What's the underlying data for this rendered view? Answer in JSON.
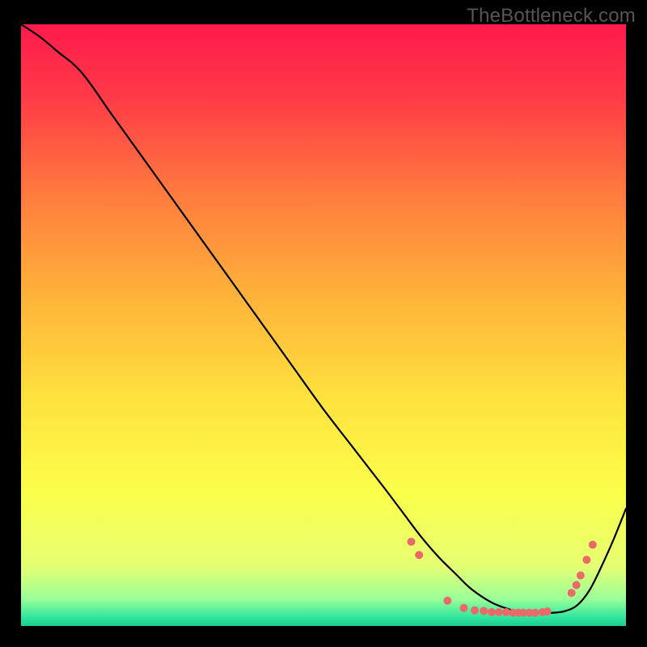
{
  "watermark": "TheBottleneck.com",
  "colors": {
    "black": "#000000",
    "curve": "#000000",
    "dot": "#ea6a6a"
  },
  "chart_data": {
    "type": "line",
    "title": "",
    "xlabel": "",
    "ylabel": "",
    "xlim": [
      0,
      100
    ],
    "ylim": [
      0,
      100
    ],
    "grid": false,
    "legend": false,
    "background": {
      "type": "vertical-gradient",
      "stops": [
        {
          "offset": 0.0,
          "color": "#ff1a4b"
        },
        {
          "offset": 0.12,
          "color": "#ff3a47"
        },
        {
          "offset": 0.28,
          "color": "#ff7a3e"
        },
        {
          "offset": 0.45,
          "color": "#ffb23a"
        },
        {
          "offset": 0.62,
          "color": "#ffe23e"
        },
        {
          "offset": 0.78,
          "color": "#fbff4a"
        },
        {
          "offset": 0.9,
          "color": "#e6ff72"
        },
        {
          "offset": 0.955,
          "color": "#9bff99"
        },
        {
          "offset": 0.985,
          "color": "#33e69f"
        },
        {
          "offset": 1.0,
          "color": "#18cf90"
        }
      ]
    },
    "series": [
      {
        "name": "bottleneck-curve",
        "x": [
          0,
          3,
          6,
          10,
          15,
          20,
          25,
          30,
          35,
          40,
          45,
          50,
          55,
          60,
          63,
          66,
          69,
          72,
          74,
          76,
          78,
          80,
          82,
          84,
          86,
          88,
          90,
          92,
          94,
          96,
          98,
          100
        ],
        "y": [
          100,
          98,
          95.5,
          92,
          85,
          78,
          71,
          64,
          57,
          50,
          43,
          36,
          29.5,
          23,
          19,
          15,
          11.5,
          8.5,
          6.5,
          5,
          3.8,
          3,
          2.4,
          2.2,
          2.2,
          2.2,
          2.5,
          3.5,
          6,
          10,
          14.5,
          19.5
        ]
      }
    ],
    "dots": [
      {
        "x": 64.5,
        "y": 14.0
      },
      {
        "x": 65.8,
        "y": 11.8
      },
      {
        "x": 70.5,
        "y": 4.2
      },
      {
        "x": 73.2,
        "y": 3.0
      },
      {
        "x": 75.0,
        "y": 2.6
      },
      {
        "x": 76.5,
        "y": 2.5
      },
      {
        "x": 77.8,
        "y": 2.3
      },
      {
        "x": 79.0,
        "y": 2.3
      },
      {
        "x": 80.2,
        "y": 2.3
      },
      {
        "x": 81.3,
        "y": 2.2
      },
      {
        "x": 82.2,
        "y": 2.2
      },
      {
        "x": 83.0,
        "y": 2.2
      },
      {
        "x": 84.0,
        "y": 2.2
      },
      {
        "x": 85.0,
        "y": 2.2
      },
      {
        "x": 86.2,
        "y": 2.3
      },
      {
        "x": 87.0,
        "y": 2.4
      },
      {
        "x": 91.0,
        "y": 5.5
      },
      {
        "x": 91.8,
        "y": 6.8
      },
      {
        "x": 92.5,
        "y": 8.4
      },
      {
        "x": 93.5,
        "y": 11.0
      },
      {
        "x": 94.5,
        "y": 13.5
      }
    ]
  }
}
